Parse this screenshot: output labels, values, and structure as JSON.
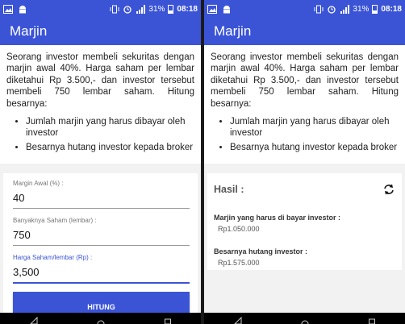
{
  "status": {
    "signal_text": "31%",
    "time": "08:18"
  },
  "app": {
    "title": "Marjin"
  },
  "question": {
    "text": "Seorang investor membeli sekuritas dengan marjin awal 40%. Harga saham per lembar diketahui Rp 3.500,- dan investor tersebut membeli 750 lembar saham. Hitung besarnya:",
    "bullets": [
      "Jumlah marjin yang harus dibayar oleh investor",
      "Besarnya hutang investor kepada broker"
    ]
  },
  "form": {
    "margin_label": "Margin Awal (%) :",
    "margin_value": "40",
    "shares_label": "Banyaknya Saham (lembar) :",
    "shares_value": "750",
    "price_label": "Harga Saham/lembar (Rp) :",
    "price_value": "3,500",
    "button_label": "HITUNG"
  },
  "result": {
    "title": "Hasil :",
    "margin_label": "Marjin yang harus di bayar investor :",
    "margin_value": "Rp1.050.000",
    "debt_label": "Besarnya hutang investor :",
    "debt_value": "Rp1.575.000"
  },
  "colors": {
    "primary": "#3b54d6",
    "background": "#f2f2f2"
  },
  "icons": [
    "image-icon",
    "android-icon",
    "vibrate-icon",
    "alarm-icon",
    "signal-icon",
    "battery-icon",
    "refresh-icon",
    "back-icon",
    "home-icon",
    "recents-icon"
  ]
}
